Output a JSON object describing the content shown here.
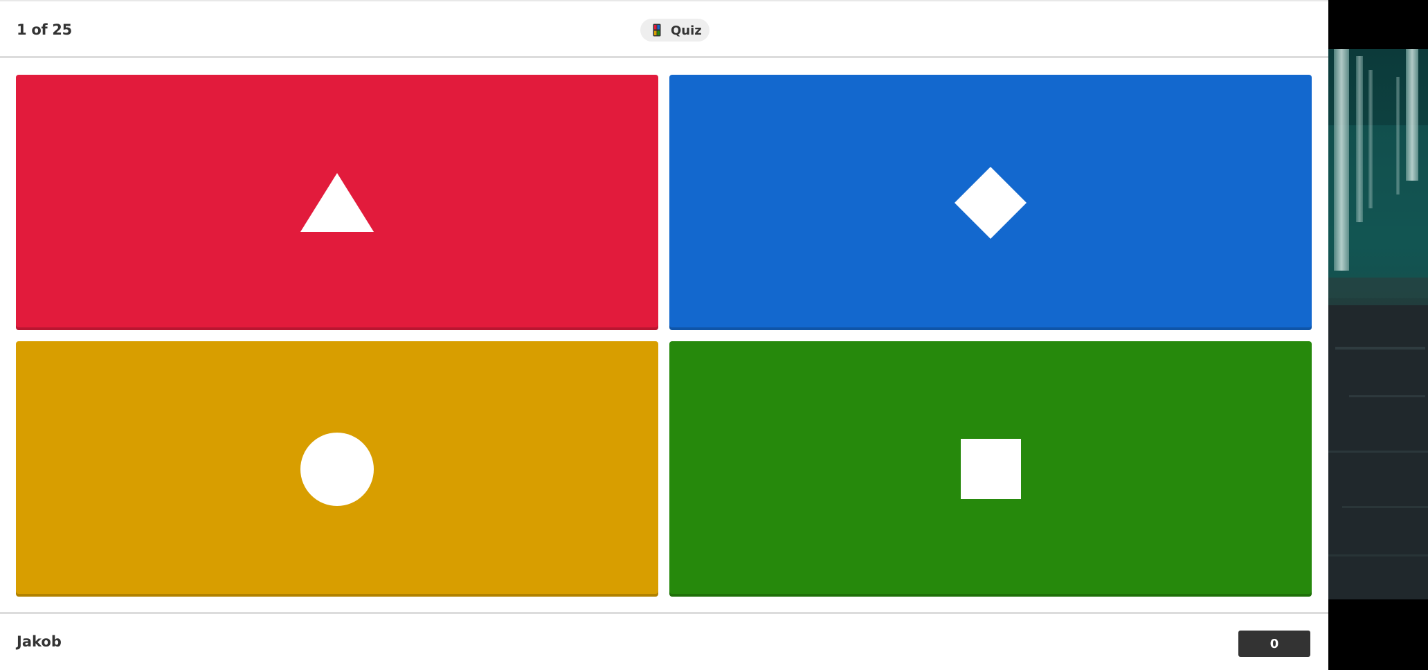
{
  "header": {
    "question_counter": "1 of 25",
    "quiz_label": "Quiz"
  },
  "answers": [
    {
      "color": "#e21b3c",
      "shape": "triangle-icon"
    },
    {
      "color": "#1368ce",
      "shape": "diamond-icon"
    },
    {
      "color": "#d89e00",
      "shape": "circle-icon"
    },
    {
      "color": "#26890c",
      "shape": "square-icon"
    }
  ],
  "footer": {
    "player_name": "Jakob",
    "score": "0"
  },
  "background_video": {
    "description_icon": "forest-video-thumbnail"
  }
}
